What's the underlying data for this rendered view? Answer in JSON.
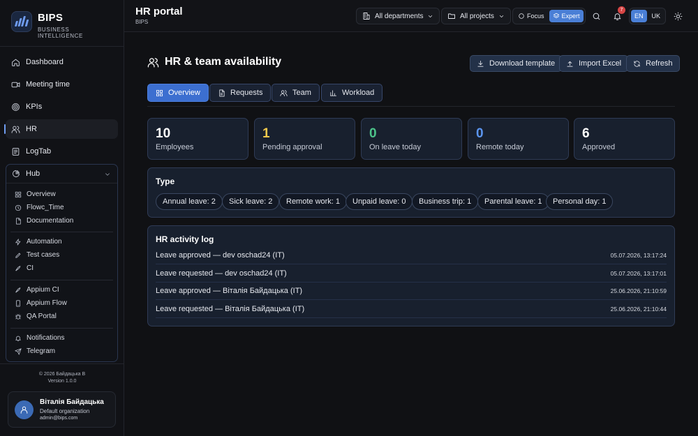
{
  "brand": {
    "name": "BIPS",
    "subtitle": "BUSINESS INTELLIGENCE"
  },
  "nav": [
    {
      "label": "Dashboard",
      "icon": "home-icon"
    },
    {
      "label": "Meeting time",
      "icon": "video-icon"
    },
    {
      "label": "KPIs",
      "icon": "target-icon"
    },
    {
      "label": "HR",
      "icon": "users-icon",
      "active": true
    },
    {
      "label": "LogTab",
      "icon": "log-icon"
    }
  ],
  "hub": {
    "label": "Hub",
    "items": [
      {
        "label": "Overview",
        "icon": "grid-icon"
      },
      {
        "label": "Flowc_Time",
        "icon": "clock-icon"
      },
      {
        "label": "Documentation",
        "icon": "document-icon"
      },
      {
        "label": "Automation",
        "icon": "zap-icon"
      },
      {
        "label": "Test cases",
        "icon": "pencil-icon"
      },
      {
        "label": "CI",
        "icon": "rocket-icon"
      },
      {
        "label": "Appium CI",
        "icon": "rocket-icon"
      },
      {
        "label": "Appium Flow",
        "icon": "phone-icon"
      },
      {
        "label": "QA Portal",
        "icon": "bug-icon"
      },
      {
        "label": "Notifications",
        "icon": "bell-icon"
      },
      {
        "label": "Telegram",
        "icon": "send-icon"
      }
    ]
  },
  "footer": {
    "copyright": "© 2026 Байдацька В",
    "version": "Version 1.0.0"
  },
  "user": {
    "name": "Віталія Байдацька",
    "org": "Default organization",
    "email": "admin@bips.com"
  },
  "topbar": {
    "title": "HR portal",
    "subtitle": "BIPS",
    "departments": "All departments",
    "projects": "All projects",
    "mode_focus": "Focus",
    "mode_expert": "Expert",
    "notifications_count": "7",
    "lang_en": "EN",
    "lang_uk": "UK"
  },
  "page": {
    "title": "HR & team availability",
    "actions": {
      "download": "Download template",
      "import": "Import Excel",
      "refresh": "Refresh"
    },
    "tabs": [
      {
        "label": "Overview",
        "active": true
      },
      {
        "label": "Requests"
      },
      {
        "label": "Team"
      },
      {
        "label": "Workload"
      }
    ]
  },
  "stats": [
    {
      "value": "10",
      "label": "Employees",
      "color": "#ffffff"
    },
    {
      "value": "1",
      "label": "Pending approval",
      "color": "#f2c94c"
    },
    {
      "value": "0",
      "label": "On leave today",
      "color": "#4cc38a"
    },
    {
      "value": "0",
      "label": "Remote today",
      "color": "#5b95f0"
    },
    {
      "value": "6",
      "label": "Approved",
      "color": "#ffffff"
    }
  ],
  "types": {
    "title": "Type",
    "chips": [
      "Annual leave: 2",
      "Sick leave: 2",
      "Remote work: 1",
      "Unpaid leave: 0",
      "Business trip: 1",
      "Parental leave: 1",
      "Personal day: 1"
    ]
  },
  "log": {
    "title": "HR activity log",
    "rows": [
      {
        "text": "Leave approved — dev oschad24 (IT)",
        "time": "05.07.2026, 13:17:24"
      },
      {
        "text": "Leave requested — dev oschad24 (IT)",
        "time": "05.07.2026, 13:17:01"
      },
      {
        "text": "Leave approved — Віталія Байдацька (IT)",
        "time": "25.06.2026, 21:10:59"
      },
      {
        "text": "Leave requested — Віталія Байдацька (IT)",
        "time": "25.06.2026, 21:10:44"
      }
    ]
  }
}
